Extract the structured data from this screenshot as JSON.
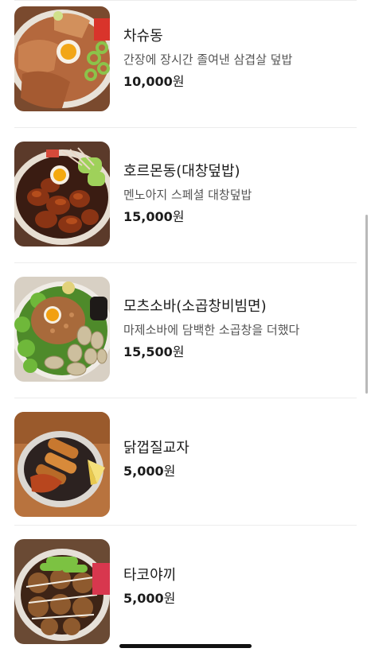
{
  "menu_items": [
    {
      "name": "차슈동",
      "description": "간장에 장시간 졸여낸 삼겹살 덮밥",
      "price": "10,000",
      "currency": "원",
      "image": "chashu-don-photo"
    },
    {
      "name": "호르몬동(대창덮밥)",
      "description": "멘노아지 스페셜 대창덮밥",
      "price": "15,000",
      "currency": "원",
      "image": "horumon-don-photo"
    },
    {
      "name": "모츠소바(소곱창비빔면)",
      "description": "마제소바에 담백한 소곱창을 더했다",
      "price": "15,500",
      "currency": "원",
      "image": "motsu-soba-photo"
    },
    {
      "name": "닭껍질교자",
      "description": "",
      "price": "5,000",
      "currency": "원",
      "image": "chicken-skin-gyoza-photo"
    },
    {
      "name": "타코야끼",
      "description": "",
      "price": "5,000",
      "currency": "원",
      "image": "takoyaki-photo"
    }
  ]
}
